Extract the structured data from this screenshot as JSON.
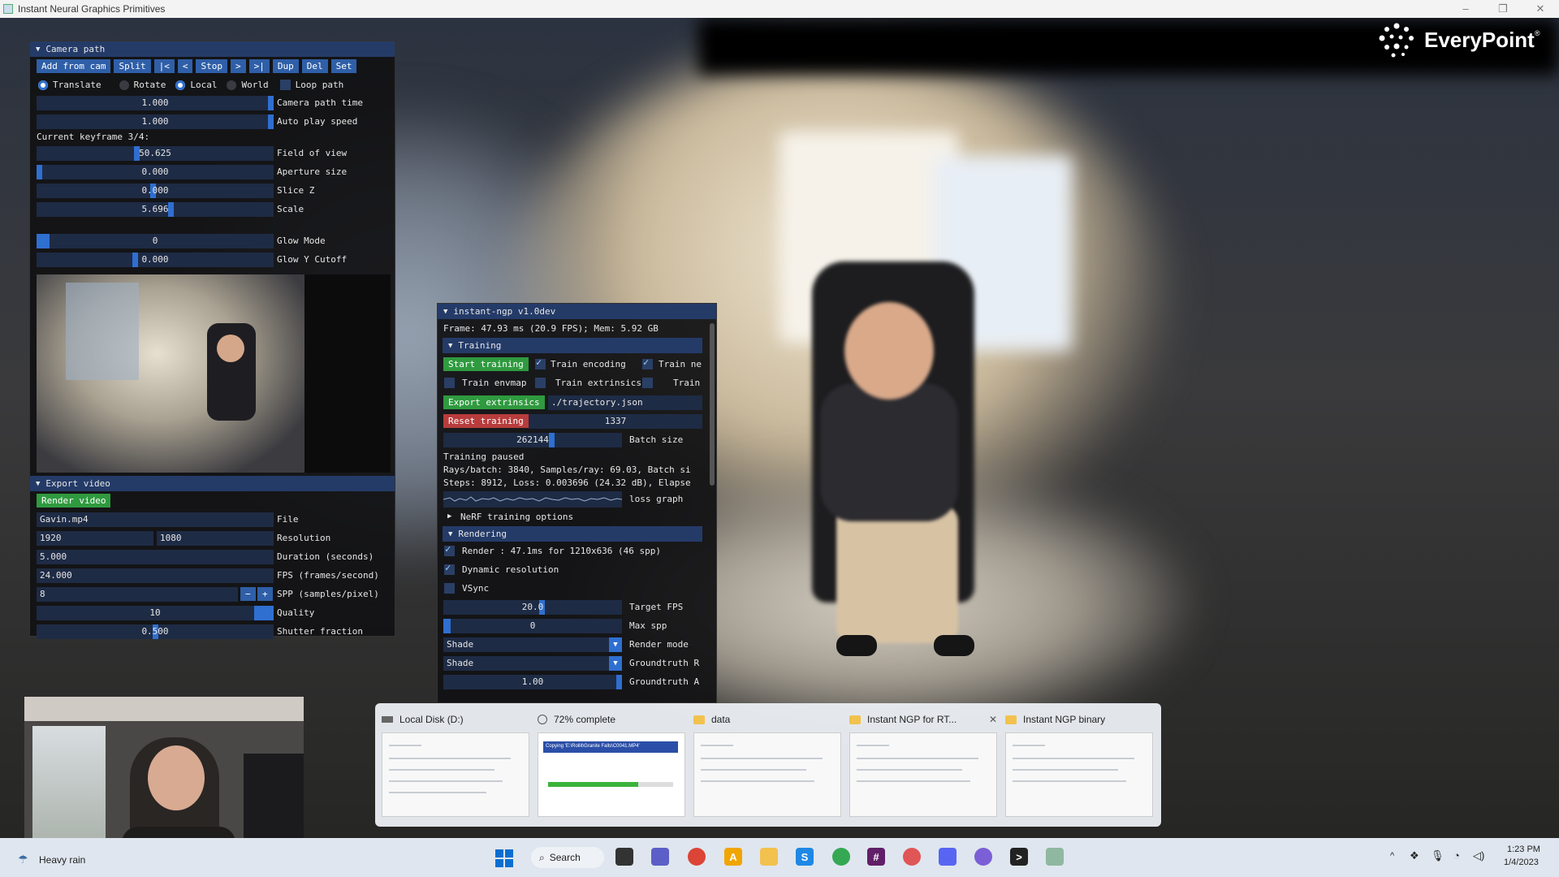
{
  "window": {
    "title": "Instant Neural Graphics Primitives",
    "min": "–",
    "max": "❐",
    "close": "✕"
  },
  "logo": {
    "text": "EveryPoint",
    "reg": "®"
  },
  "camera_path": {
    "header": "Camera path",
    "toolbar": [
      "Add from cam",
      "Split",
      "|<",
      "<",
      "Stop",
      ">",
      ">|",
      "Dup",
      "Del",
      "Set"
    ],
    "mode": {
      "translate": "Translate",
      "rotate": "Rotate",
      "local": "Local",
      "world": "World",
      "loop": "Loop path"
    },
    "camera_path_time": {
      "value": "1.000",
      "label": "Camera path time"
    },
    "auto_play_speed": {
      "value": "1.000",
      "label": "Auto play speed"
    },
    "current_keyframe": "Current keyframe 3/4:",
    "fov": {
      "value": "50.625",
      "label": "Field of view"
    },
    "aperture": {
      "value": "0.000",
      "label": "Aperture size"
    },
    "slice_z": {
      "value": "0.000",
      "label": "Slice Z"
    },
    "scale": {
      "value": "5.696",
      "label": "Scale"
    },
    "glow_mode": {
      "value": "0",
      "label": "Glow Mode"
    },
    "glow_y": {
      "value": "0.000",
      "label": "Glow Y Cutoff"
    }
  },
  "export_video": {
    "header": "Export video",
    "render_button": "Render video",
    "file": {
      "value": "Gavin.mp4",
      "label": "File"
    },
    "resolution": {
      "w": "1920",
      "h": "1080",
      "label": "Resolution"
    },
    "duration": {
      "value": "5.000",
      "label": "Duration (seconds)"
    },
    "fps": {
      "value": "24.000",
      "label": "FPS (frames/second)"
    },
    "spp": {
      "value": "8",
      "minus": "−",
      "plus": "+",
      "label": "SPP (samples/pixel)"
    },
    "quality": {
      "value": "10",
      "label": "Quality"
    },
    "shutter": {
      "value": "0.500",
      "label": "Shutter fraction"
    }
  },
  "ngp": {
    "header": "instant-ngp v1.0dev",
    "frame_stats": "Frame: 47.93 ms (20.9 FPS); Mem: 5.92 GB",
    "training": {
      "header": "Training",
      "start": "Start training",
      "train_encoding": "Train encoding",
      "train_ne": "Train ne",
      "train_envmap": "Train envmap",
      "train_extrinsics": "Train extrinsics",
      "train_tail": "Train",
      "export_extrinsics": "Export extrinsics",
      "trajectory": "./trajectory.json",
      "reset": "Reset training",
      "seed": "1337",
      "batch_value": "262144",
      "batch_label": "Batch size",
      "status": "Training paused",
      "rays": "Rays/batch: 3840, Samples/ray: 69.03, Batch si",
      "steps": "Steps: 8912, Loss: 0.003696 (24.32 dB), Elapse",
      "loss_graph": "loss graph",
      "nerf_options": "NeRF training options"
    },
    "rendering": {
      "header": "Rendering",
      "render_stats": "Render : 47.1ms for 1210x636 (46 spp)",
      "dynamic_res": "Dynamic resolution",
      "vsync": "VSync",
      "target_fps": {
        "value": "20.0",
        "label": "Target FPS"
      },
      "max_spp": {
        "value": "0",
        "label": "Max spp"
      },
      "render_mode": {
        "value": "Shade",
        "label": "Render mode"
      },
      "groundtruth_r": {
        "value": "Shade",
        "label": "Groundtruth R"
      },
      "groundtruth_a": {
        "value": "1.00",
        "label": "Groundtruth A"
      }
    }
  },
  "switcher": {
    "items": [
      {
        "title": "Local Disk (D:)"
      },
      {
        "title": "72% complete",
        "dialog": "Copying 'E:\\Rollit\\Granite Falls\\C0041.MP4'",
        "progress_fraction": 0.72
      },
      {
        "title": "data"
      },
      {
        "title": "Instant NGP for RT...",
        "close": "✕"
      },
      {
        "title": "Instant NGP binary"
      }
    ]
  },
  "taskbar": {
    "weather": "Heavy rain",
    "search": "Search",
    "time": "1:23 PM",
    "date": "1/4/2023"
  }
}
